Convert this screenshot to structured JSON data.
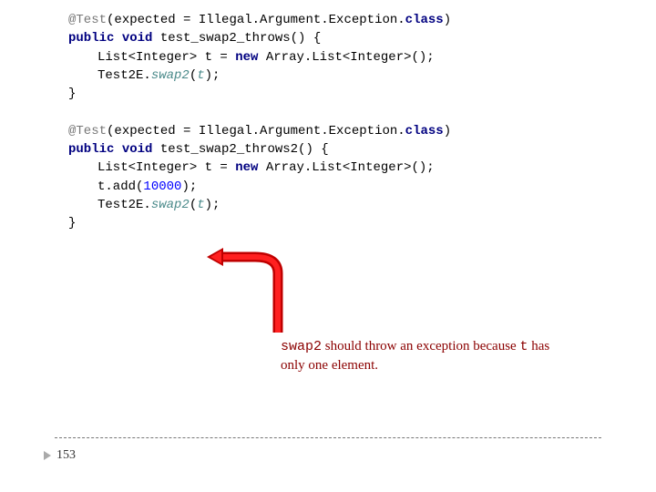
{
  "block1": {
    "l1_anno": "@Test",
    "l1_rest": "(expected = Illegal.Argument.Exception.",
    "l1_class": "class",
    "l1_end": ")",
    "l2_pub": "public ",
    "l2_void": "void",
    "l2_name": " test_swap2_throws() {",
    "l3_a": "List<Integer> ",
    "l3_t": "t",
    "l3_b": " = ",
    "l3_new": "new",
    "l3_c": " Array.List<Integer>();",
    "l4_a": "Test2E.",
    "l4_m": "swap2",
    "l4_p1": "(",
    "l4_arg": "t",
    "l4_p2": ");",
    "l5": "}"
  },
  "block2": {
    "l1_anno": "@Test",
    "l1_rest": "(expected = Illegal.Argument.Exception.",
    "l1_class": "class",
    "l1_end": ")",
    "l2_pub": "public ",
    "l2_void": "void",
    "l2_name": " test_swap2_throws2() {",
    "l3_a": "List<Integer> ",
    "l3_t": "t",
    "l3_b": " = ",
    "l3_new": "new",
    "l3_c": " Array.List<Integer>();",
    "l4_a": "t",
    "l4_b": ".add(",
    "l4_num": "10000",
    "l4_c": ");",
    "l5_a": "Test2E.",
    "l5_m": "swap2",
    "l5_p1": "(",
    "l5_arg": "t",
    "l5_p2": ");",
    "l6": "}"
  },
  "note": {
    "s1": "swap2",
    "s2": " should throw an exception because ",
    "s3": "t",
    "s4": " has only one element."
  },
  "page": "153"
}
